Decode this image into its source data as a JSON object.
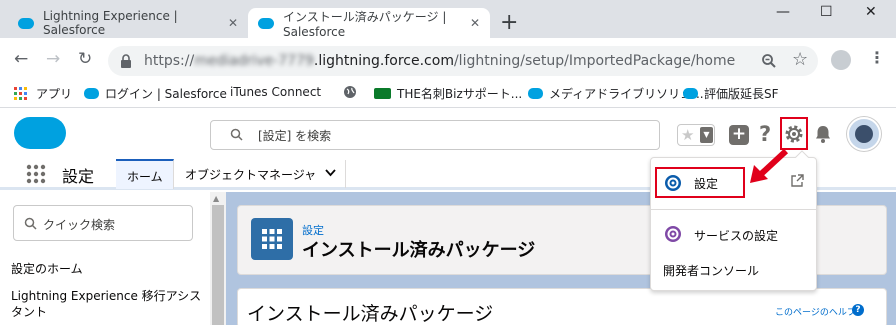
{
  "browser": {
    "tabs": [
      {
        "label": "Lightning Experience | Salesforce",
        "close": "✕"
      },
      {
        "label": "インストール済みパッケージ | Salesforce",
        "close": "✕"
      }
    ],
    "new_tab": "+",
    "window": {
      "minimize": "—",
      "maximize": "☐",
      "close": "✕"
    },
    "url": {
      "scheme": "https://",
      "host_blurred": "mediadrive-7779",
      "domain": ".lightning.force.com",
      "path": "/lightning/setup/ImportedPackage/home"
    },
    "bookmarks": [
      "アプリ",
      "ログイン | Salesforce",
      "iTunes Connect",
      "",
      "THE名刺Bizサポート...",
      "メディアドライブリソリュ...",
      "評価版延長SF"
    ]
  },
  "sf": {
    "search_placeholder": "[設定] を検索",
    "app_name": "設定",
    "nav_tabs": [
      "ホーム",
      "オブジェクトマネージャ"
    ],
    "sidebar": {
      "quick_find_placeholder": "クイック検索",
      "items": [
        "設定のホーム",
        "Lightning Experience 移行アシスタント"
      ]
    },
    "header": {
      "eyebrow": "設定",
      "title": "インストール済みパッケージ"
    },
    "body_title": "インストール済みパッケージ",
    "help_link": "このページのヘルプ",
    "dropdown": {
      "items": [
        {
          "label": "設定",
          "icon": "setup-gear-icon"
        },
        {
          "label": "サービスの設定",
          "icon": "service-gear-icon"
        },
        {
          "label": "開発者コンソール",
          "icon": ""
        }
      ]
    }
  },
  "colors": {
    "brand": "#00a1e0",
    "annotation_red": "#e0001b",
    "link": "#006dcc",
    "accent_nav": "#1b5fbb"
  }
}
